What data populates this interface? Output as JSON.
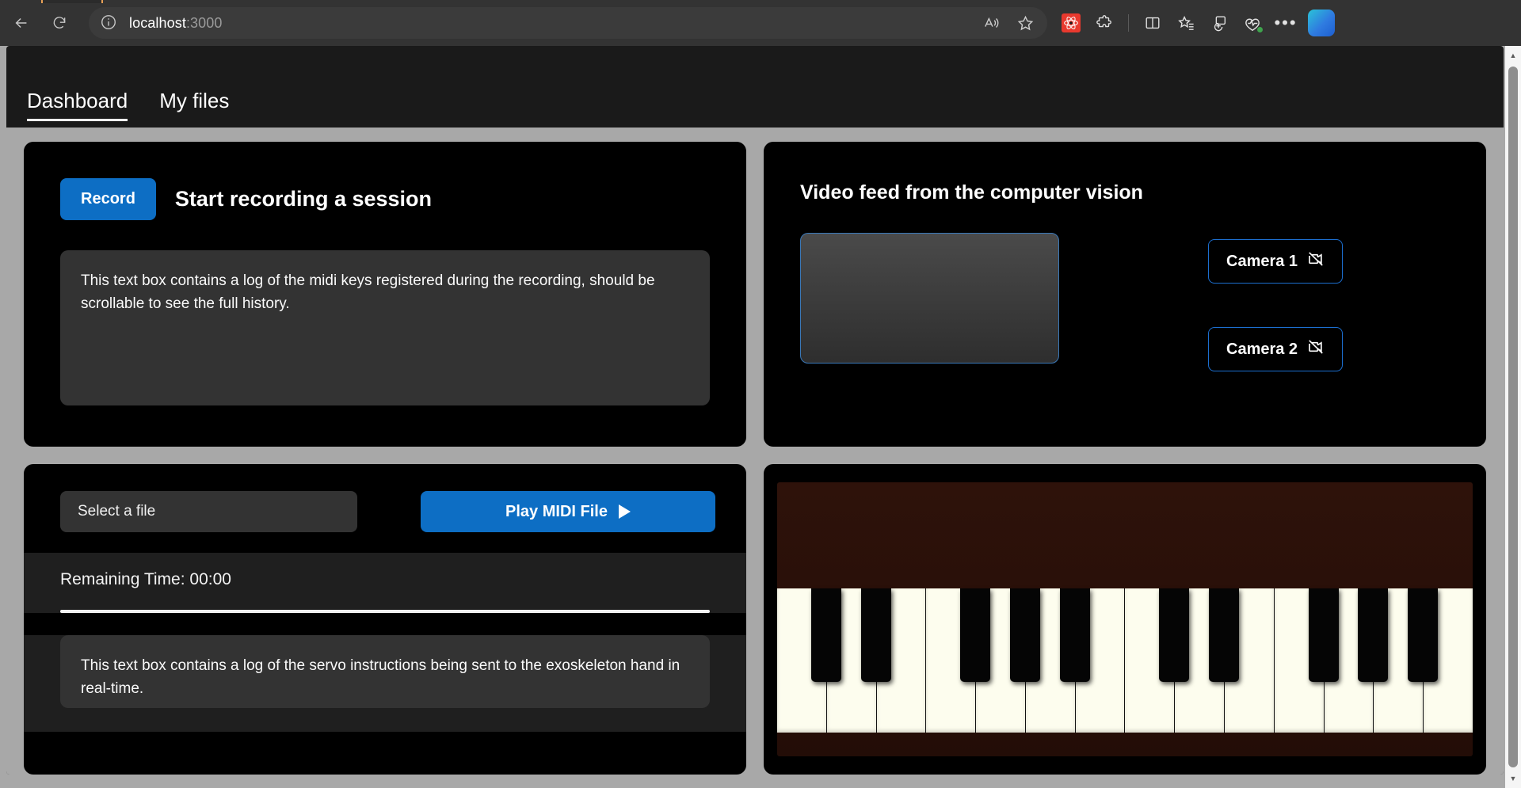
{
  "browser": {
    "url_host": "localhost",
    "url_port": ":3000",
    "back_label": "Back",
    "refresh_label": "Refresh",
    "site_info_label": "View site information",
    "read_aloud_label": "Read aloud",
    "favorite_label": "Add this page to favorites",
    "extension_label": "React Developer Tools",
    "extensions_label": "Extensions",
    "split_screen_label": "Split screen",
    "favorites_label": "Favorites",
    "collections_label": "Collections",
    "browser_essentials_label": "Browser essentials",
    "settings_label": "Settings and more",
    "copilot_label": "Copilot"
  },
  "app": {
    "tabs": [
      {
        "label": "Dashboard",
        "active": true
      },
      {
        "label": "My files",
        "active": false
      }
    ]
  },
  "record_panel": {
    "record_button": "Record",
    "title": "Start recording a session",
    "midi_log": "This text box contains a log of the midi keys registered during the recording, should be scrollable to see the full history."
  },
  "video_panel": {
    "title": "Video feed from the computer vision",
    "cameras": [
      {
        "label": "Camera 1",
        "icon": "camera-off-icon"
      },
      {
        "label": "Camera 2",
        "icon": "camera-off-icon"
      }
    ]
  },
  "player_panel": {
    "file_select_value": "Select a file",
    "play_button": "Play MIDI File",
    "play_icon": "play-triangle-icon",
    "remaining_time_label": "Remaining Time: 00:00",
    "progress_percent": 100,
    "servo_log": "This text box contains a log of the servo instructions being sent to the exoskeleton hand in real-time."
  },
  "piano_panel": {
    "white_key_count": 14,
    "black_key_pattern": [
      1,
      1,
      0,
      1,
      1,
      1,
      0,
      1,
      1,
      0,
      1,
      1,
      1,
      0
    ],
    "white_key_color": "#fdfdee",
    "black_key_color": "#050505",
    "case_color": "#2e120a"
  },
  "colors": {
    "accent_blue": "#0d6ec4",
    "panel_black": "#000000",
    "page_gray": "#a8a8a8",
    "log_gray": "#333333",
    "chrome_gray": "#333333"
  }
}
